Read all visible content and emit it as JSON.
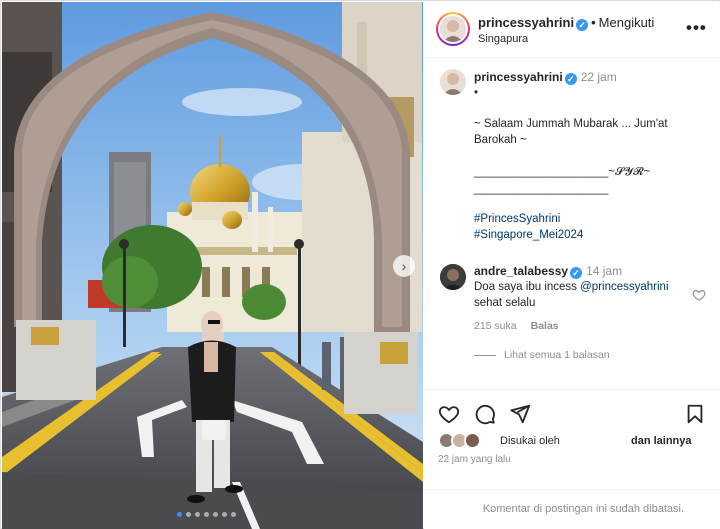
{
  "post": {
    "username": "princessyahrini",
    "follow_status": "Mengikuti",
    "separator": "•",
    "location": "Singapura",
    "more_label": "•••",
    "carousel": {
      "slide_count": 7,
      "active_index": 0,
      "next_arrow": "›"
    }
  },
  "caption": {
    "username": "princessyahrini",
    "time": "22 jam",
    "lines": [
      "•",
      "~ Salaam Jummah Mubarak ... Jum'at",
      "Barokah ~",
      "_____________________~𝓢𝓨𝓡~",
      "_____________________"
    ],
    "hashtags": [
      "#PrincesSyahrini",
      "#Singapore_Mei2024"
    ]
  },
  "comment": {
    "username": "andre_talabessy",
    "time": "14 jam",
    "text_before": "Doa saya ibu incess ",
    "mention": "@princessyahrini",
    "text_line2": "sehat selalu",
    "likes": "215 suka",
    "reply_label": "Balas",
    "view_replies": "Lihat semua 1 balasan"
  },
  "actions": {
    "liked_by_label": "Disukai oleh",
    "and_others_label": "dan lainnya",
    "posted_time": "22 jam yang lalu"
  },
  "footer": {
    "comments_limited": "Komentar di postingan ini sudah dibatasi."
  },
  "icons": {
    "verified": "verified-badge-icon",
    "like": "heart-icon",
    "comment": "comment-bubble-icon",
    "share": "paper-plane-icon",
    "save": "bookmark-icon"
  },
  "colors": {
    "verified": "#3897f0",
    "hashtag": "#00376b",
    "muted": "#8e8e8e",
    "active_dot": "#3b8df0"
  }
}
